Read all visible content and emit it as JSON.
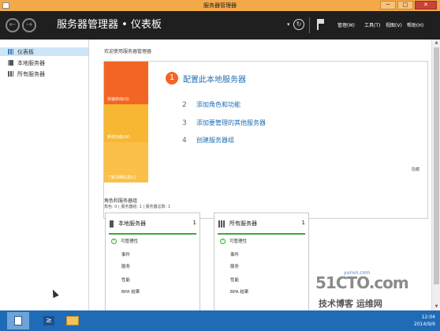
{
  "window": {
    "title": "服务器管理器",
    "minimize": "─",
    "maximize": "□",
    "close": "✕"
  },
  "header": {
    "breadcrumb": "服务器管理器 • 仪表板",
    "back_glyph": "←",
    "forward_glyph": "→",
    "dropdown_glyph": "▾",
    "refresh_glyph": "↻",
    "menus": {
      "manage": "管理(M)",
      "tools": "工具(T)",
      "view": "视图(V)",
      "help": "帮助(H)"
    }
  },
  "sidebar": {
    "items": [
      {
        "label": "仪表板",
        "icon": "dashboard-icon",
        "selected": true
      },
      {
        "label": "本地服务器",
        "icon": "server-icon",
        "selected": false
      },
      {
        "label": "所有服务器",
        "icon": "servers-icon",
        "selected": false
      }
    ]
  },
  "welcome": {
    "heading": "欢迎使用服务器管理器",
    "tiles": [
      "快速启动(Q)",
      "新增功能(W)",
      "了解详细信息(L)"
    ],
    "steps": [
      {
        "number": "1",
        "label": "配置此本地服务器"
      },
      {
        "number": "2",
        "label": "添加角色和功能"
      },
      {
        "number": "3",
        "label": "添加要管理的其他服务器"
      },
      {
        "number": "4",
        "label": "创建服务器组"
      }
    ],
    "hide": "隐藏"
  },
  "roles": {
    "title": "角色和服务器组",
    "summary": "角色: 0 | 服务器组: 1 | 服务器总数: 1"
  },
  "cards": [
    {
      "name": "本地服务器",
      "count": "1",
      "rows": [
        "可管理性",
        "事件",
        "服务",
        "性能",
        "BPA 结果"
      ]
    },
    {
      "name": "所有服务器",
      "count": "1",
      "rows": [
        "可管理性",
        "事件",
        "服务",
        "性能",
        "BPA 结果"
      ]
    }
  ],
  "scrollbar": {
    "up": "▲",
    "down": "▼"
  },
  "watermark": {
    "logo": "51CTO.com",
    "site": "yunvn.com",
    "slogan": "技术博客 运维网"
  },
  "taskbar": {
    "ps_glyph": "≥",
    "clock_time": "12:04",
    "clock_date": "2014/9/9"
  },
  "colors": {
    "titlebar": "#f3a948",
    "header": "#1f1f1f",
    "accent_orange": "#f26522",
    "tile_yellow": "#f7b733",
    "link_blue": "#1f6fb3",
    "status_green": "#3aaa35",
    "taskbar": "#1f6bb5"
  }
}
